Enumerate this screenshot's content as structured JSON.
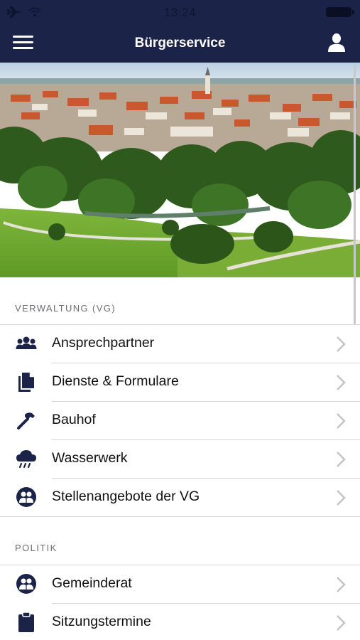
{
  "status": {
    "time": "13:24"
  },
  "nav": {
    "title": "Bürgerservice"
  },
  "sections": [
    {
      "header": "VERWALTUNG (VG)",
      "items": [
        {
          "label": "Ansprechpartner",
          "icon": "people-group-icon"
        },
        {
          "label": "Dienste & Formulare",
          "icon": "documents-icon"
        },
        {
          "label": "Bauhof",
          "icon": "hammer-icon"
        },
        {
          "label": "Wasserwerk",
          "icon": "rain-cloud-icon"
        },
        {
          "label": "Stellenangebote der VG",
          "icon": "people-circle-icon"
        }
      ]
    },
    {
      "header": "POLITIK",
      "items": [
        {
          "label": "Gemeinderat",
          "icon": "people-circle-icon"
        },
        {
          "label": "Sitzungstermine",
          "icon": "clipboard-icon"
        }
      ]
    }
  ],
  "colors": {
    "navbar": "#1b2348",
    "icon": "#1b2348",
    "chevron": "#c4c4c8"
  }
}
